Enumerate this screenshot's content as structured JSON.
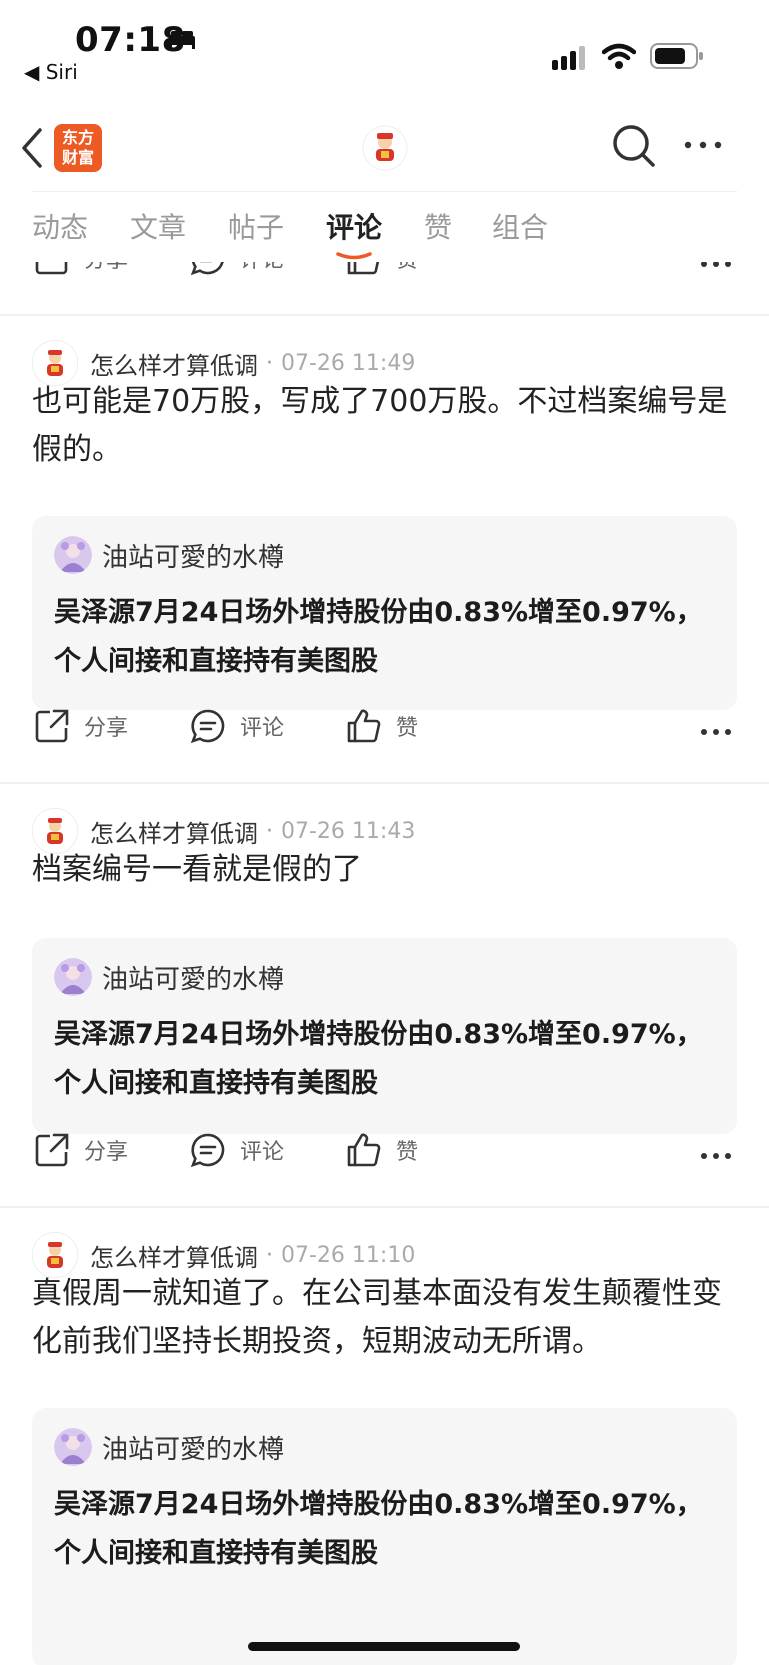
{
  "status_bar": {
    "time": "07:18",
    "back_app": "◀ Siri",
    "icons": [
      "bed-icon",
      "signal-icon",
      "wifi-icon",
      "battery-icon"
    ]
  },
  "nav": {
    "logo_line1": "东方",
    "logo_line2": "财富",
    "icons": [
      "back-icon",
      "avatar",
      "search-icon",
      "more-icon"
    ]
  },
  "tabs": [
    {
      "label": "动态",
      "active": false
    },
    {
      "label": "文章",
      "active": false
    },
    {
      "label": "帖子",
      "active": false
    },
    {
      "label": "评论",
      "active": true
    },
    {
      "label": "赞",
      "active": false
    },
    {
      "label": "组合",
      "active": false
    }
  ],
  "actions": {
    "share": "分享",
    "comment": "评论",
    "like": "赞"
  },
  "posts": [
    {
      "author": "怎么样才算低调",
      "separator": "·",
      "time": "07-26 11:49",
      "text": "也可能是70万股，写成了700万股。不过档案编号是假的。",
      "quote_author": "油站可愛的水樽",
      "quote_text": "吴泽源7月24日场外增持股份由0.83%增至0.97%，个人间接和直接持有美图股"
    },
    {
      "author": "怎么样才算低调",
      "separator": "·",
      "time": "07-26 11:43",
      "text": "档案编号一看就是假的了",
      "quote_author": "油站可愛的水樽",
      "quote_text": "吴泽源7月24日场外增持股份由0.83%增至0.97%，个人间接和直接持有美图股"
    },
    {
      "author": "怎么样才算低调",
      "separator": "·",
      "time": "07-26 11:10",
      "text": "真假周一就知道了。在公司基本面没有发生颠覆性变化前我们坚持长期投资，短期波动无所谓。",
      "quote_author": "油站可愛的水樽",
      "quote_text": "吴泽源7月24日场外增持股份由0.83%增至0.97%，个人间接和直接持有美图股"
    }
  ],
  "colors": {
    "accent": "#ee5a24",
    "card_bg": "#f6f6f7",
    "muted": "#9a9a9a"
  }
}
